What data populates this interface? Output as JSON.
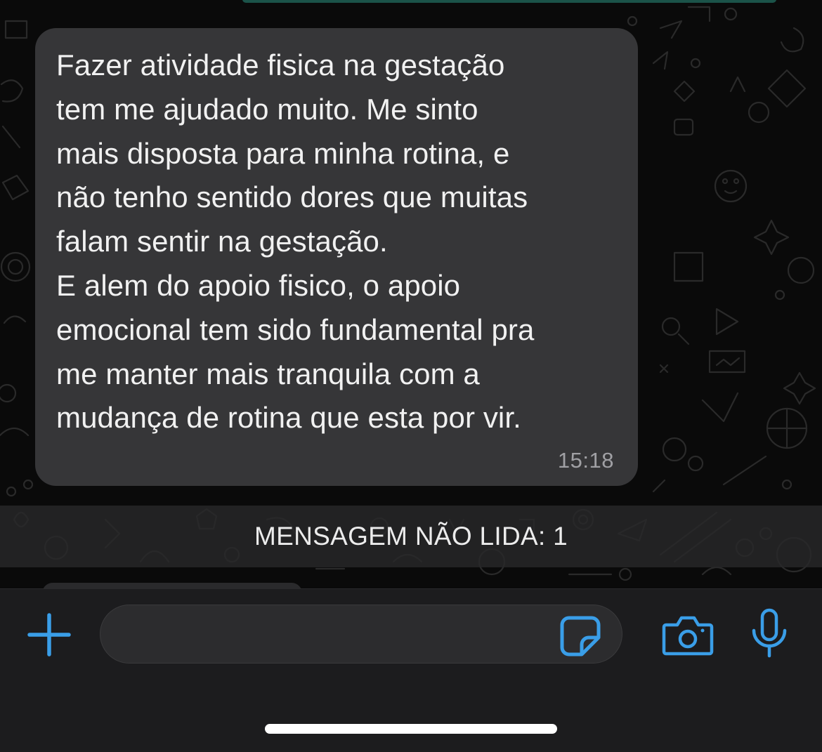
{
  "message": {
    "text": "Fazer atividade fisica na gestação\ntem me ajudado muito. Me sinto\nmais disposta para minha rotina, e\nnão tenho sentido dores que muitas\nfalam sentir na gestação.\nE alem do apoio fisico, o apoio\nemocional tem sido fundamental pra\nme manter mais tranquila com a\nmudança de rotina que esta por vir.",
    "time": "15:18"
  },
  "unread_banner": {
    "label": "MENSAGEM NÃO LIDA: 1"
  },
  "composer": {
    "input_value": "",
    "input_placeholder": "",
    "icons": [
      "plus-icon",
      "sticker-icon",
      "camera-icon",
      "microphone-icon"
    ]
  },
  "colors": {
    "accent": "#3a9ee8",
    "bubble": "#363638",
    "background": "#0a0a0a",
    "composer_bg": "#1c1c1e"
  }
}
